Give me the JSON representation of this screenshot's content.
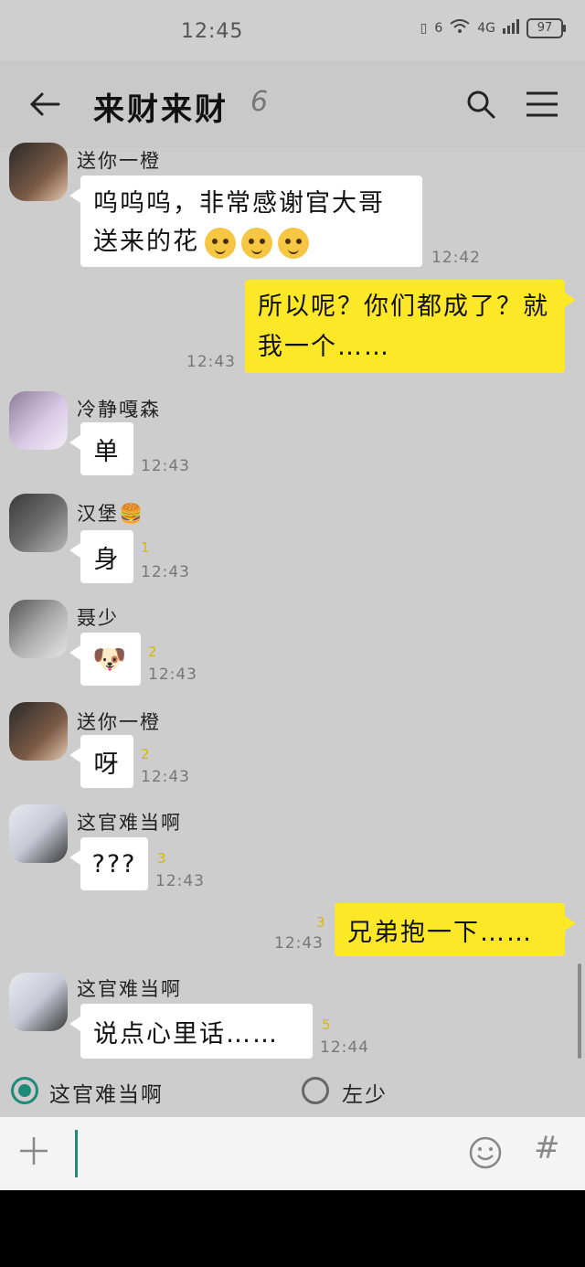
{
  "status": {
    "time": "12:45",
    "battery": "97",
    "network": "4G",
    "sim": "6"
  },
  "header": {
    "title": "来财来财",
    "member_count": "6"
  },
  "messages": [
    {
      "sender": "送你一橙",
      "text": "呜呜呜，非常感谢官大哥送来的花",
      "time": "12:42"
    },
    {
      "text": "所以呢？你们都成了？就我一个……",
      "time": "12:43"
    },
    {
      "sender": "冷静嘎森",
      "text": "单",
      "time": "12:43"
    },
    {
      "sender": "汉堡🍔",
      "text": "身",
      "time": "12:43",
      "reads": "1"
    },
    {
      "sender": "聂少",
      "text": "🐶",
      "time": "12:43",
      "reads": "2"
    },
    {
      "sender": "送你一橙",
      "text": "呀",
      "time": "12:43",
      "reads": "2"
    },
    {
      "sender": "这官难当啊",
      "text": "???",
      "time": "12:43",
      "reads": "3"
    },
    {
      "text": "兄弟抱一下……",
      "time": "12:43",
      "reads": "3"
    },
    {
      "sender": "这官难当啊",
      "text": "说点心里话……",
      "time": "12:44",
      "reads": "5"
    }
  ],
  "poll": {
    "option1": "这官难当啊",
    "option2": "左少"
  },
  "input": {
    "placeholder": "",
    "hash": "#"
  },
  "colors": {
    "accent": "#1e8a78",
    "my_bubble": "#fde828",
    "background": "#cdcdcd"
  }
}
